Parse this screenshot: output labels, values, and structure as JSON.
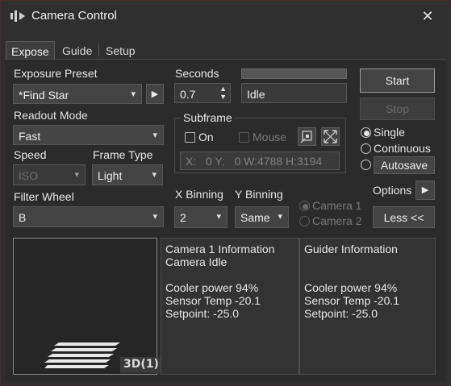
{
  "window": {
    "title": "Camera Control",
    "close_glyph": "✕",
    "app_icon": "camera-control-icon"
  },
  "tabs": [
    {
      "label": "Expose",
      "active": true
    },
    {
      "label": "Guide",
      "active": false
    },
    {
      "label": "Setup",
      "active": false
    }
  ],
  "expose": {
    "exposure_preset": {
      "label": "Exposure Preset",
      "value": "*Find Star"
    },
    "readout_mode": {
      "label": "Readout Mode",
      "value": "Fast"
    },
    "speed": {
      "label": "Speed",
      "value": "ISO"
    },
    "frame_type": {
      "label": "Frame Type",
      "value": "Light"
    },
    "filter_wheel": {
      "label": "Filter Wheel",
      "value": "B"
    },
    "seconds": {
      "label": "Seconds",
      "value": "0.7"
    },
    "status": {
      "value": "Idle",
      "progress": 0
    },
    "subframe": {
      "label": "Subframe",
      "on_label": "On",
      "mouse_label": "Mouse",
      "coords": "X:   0 Y:   0 W:4788 H:3194"
    },
    "x_binning": {
      "label": "X Binning",
      "value": "2"
    },
    "y_binning": {
      "label": "Y Binning",
      "value": "Same"
    },
    "camera_select": [
      {
        "label": "Camera 1",
        "checked": true
      },
      {
        "label": "Camera 2",
        "checked": false
      }
    ],
    "start_label": "Start",
    "stop_label": "Stop",
    "mode": [
      {
        "label": "Single",
        "checked": true
      },
      {
        "label": "Continuous",
        "checked": false
      },
      {
        "label": "Autosave",
        "checked": false
      }
    ],
    "options_label": "Options",
    "less_label": "Less <<"
  },
  "preview": {
    "badge": "3D(1)"
  },
  "camera1_info": {
    "title": "Camera 1 Information",
    "status": "Camera Idle",
    "cooler_power": "Cooler power 94%",
    "sensor_temp": "Sensor Temp -20.1",
    "setpoint": "Setpoint: -25.0"
  },
  "guider_info": {
    "title": "Guider Information",
    "cooler_power": "Cooler power 94%",
    "sensor_temp": "Sensor Temp -20.1",
    "setpoint": "Setpoint: -25.0"
  }
}
